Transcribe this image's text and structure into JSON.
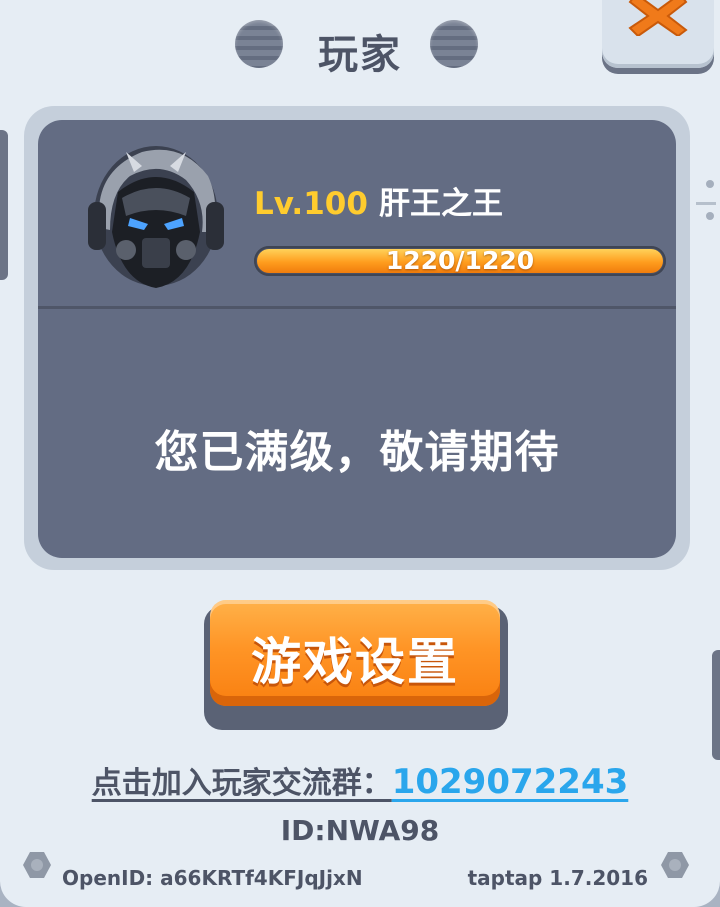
{
  "dialog": {
    "title": "玩家",
    "close_icon": "close-x-icon"
  },
  "player": {
    "level_label": "Lv.100",
    "name": "肝王之王",
    "xp_text": "1220/1220",
    "xp_progress": 1.0,
    "avatar_icon": "robot-avatar-icon",
    "max_level_message": "您已满级，敬请期待",
    "id_text": "ID:NWA98"
  },
  "settings_button": {
    "label": "游戏设置"
  },
  "community": {
    "label": "点击加入玩家交流群：",
    "group_number": "1029072243"
  },
  "footer": {
    "open_id": "OpenID: a66KRTf4KFJqJjxN",
    "version": "taptap 1.7.2016"
  },
  "colors": {
    "accent_orange": "#ff9526",
    "level_gold": "#ffcc2e",
    "link_blue": "#2aa6ec",
    "card_dark": "#636c83",
    "text_dark": "#4d5466"
  }
}
